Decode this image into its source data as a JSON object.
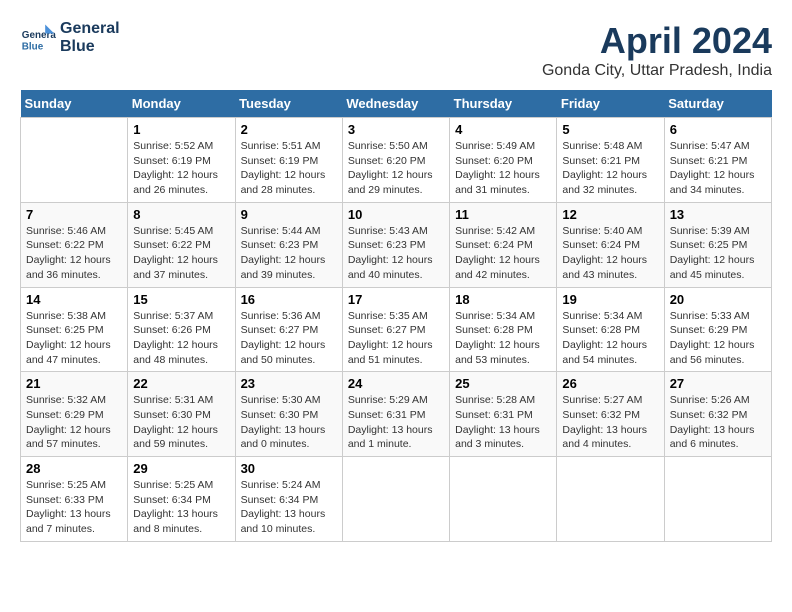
{
  "header": {
    "logo_line1": "General",
    "logo_line2": "Blue",
    "month_year": "April 2024",
    "location": "Gonda City, Uttar Pradesh, India"
  },
  "days_of_week": [
    "Sunday",
    "Monday",
    "Tuesday",
    "Wednesday",
    "Thursday",
    "Friday",
    "Saturday"
  ],
  "weeks": [
    [
      {
        "day": "",
        "info": ""
      },
      {
        "day": "1",
        "info": "Sunrise: 5:52 AM\nSunset: 6:19 PM\nDaylight: 12 hours\nand 26 minutes."
      },
      {
        "day": "2",
        "info": "Sunrise: 5:51 AM\nSunset: 6:19 PM\nDaylight: 12 hours\nand 28 minutes."
      },
      {
        "day": "3",
        "info": "Sunrise: 5:50 AM\nSunset: 6:20 PM\nDaylight: 12 hours\nand 29 minutes."
      },
      {
        "day": "4",
        "info": "Sunrise: 5:49 AM\nSunset: 6:20 PM\nDaylight: 12 hours\nand 31 minutes."
      },
      {
        "day": "5",
        "info": "Sunrise: 5:48 AM\nSunset: 6:21 PM\nDaylight: 12 hours\nand 32 minutes."
      },
      {
        "day": "6",
        "info": "Sunrise: 5:47 AM\nSunset: 6:21 PM\nDaylight: 12 hours\nand 34 minutes."
      }
    ],
    [
      {
        "day": "7",
        "info": "Sunrise: 5:46 AM\nSunset: 6:22 PM\nDaylight: 12 hours\nand 36 minutes."
      },
      {
        "day": "8",
        "info": "Sunrise: 5:45 AM\nSunset: 6:22 PM\nDaylight: 12 hours\nand 37 minutes."
      },
      {
        "day": "9",
        "info": "Sunrise: 5:44 AM\nSunset: 6:23 PM\nDaylight: 12 hours\nand 39 minutes."
      },
      {
        "day": "10",
        "info": "Sunrise: 5:43 AM\nSunset: 6:23 PM\nDaylight: 12 hours\nand 40 minutes."
      },
      {
        "day": "11",
        "info": "Sunrise: 5:42 AM\nSunset: 6:24 PM\nDaylight: 12 hours\nand 42 minutes."
      },
      {
        "day": "12",
        "info": "Sunrise: 5:40 AM\nSunset: 6:24 PM\nDaylight: 12 hours\nand 43 minutes."
      },
      {
        "day": "13",
        "info": "Sunrise: 5:39 AM\nSunset: 6:25 PM\nDaylight: 12 hours\nand 45 minutes."
      }
    ],
    [
      {
        "day": "14",
        "info": "Sunrise: 5:38 AM\nSunset: 6:25 PM\nDaylight: 12 hours\nand 47 minutes."
      },
      {
        "day": "15",
        "info": "Sunrise: 5:37 AM\nSunset: 6:26 PM\nDaylight: 12 hours\nand 48 minutes."
      },
      {
        "day": "16",
        "info": "Sunrise: 5:36 AM\nSunset: 6:27 PM\nDaylight: 12 hours\nand 50 minutes."
      },
      {
        "day": "17",
        "info": "Sunrise: 5:35 AM\nSunset: 6:27 PM\nDaylight: 12 hours\nand 51 minutes."
      },
      {
        "day": "18",
        "info": "Sunrise: 5:34 AM\nSunset: 6:28 PM\nDaylight: 12 hours\nand 53 minutes."
      },
      {
        "day": "19",
        "info": "Sunrise: 5:34 AM\nSunset: 6:28 PM\nDaylight: 12 hours\nand 54 minutes."
      },
      {
        "day": "20",
        "info": "Sunrise: 5:33 AM\nSunset: 6:29 PM\nDaylight: 12 hours\nand 56 minutes."
      }
    ],
    [
      {
        "day": "21",
        "info": "Sunrise: 5:32 AM\nSunset: 6:29 PM\nDaylight: 12 hours\nand 57 minutes."
      },
      {
        "day": "22",
        "info": "Sunrise: 5:31 AM\nSunset: 6:30 PM\nDaylight: 12 hours\nand 59 minutes."
      },
      {
        "day": "23",
        "info": "Sunrise: 5:30 AM\nSunset: 6:30 PM\nDaylight: 13 hours\nand 0 minutes."
      },
      {
        "day": "24",
        "info": "Sunrise: 5:29 AM\nSunset: 6:31 PM\nDaylight: 13 hours\nand 1 minute."
      },
      {
        "day": "25",
        "info": "Sunrise: 5:28 AM\nSunset: 6:31 PM\nDaylight: 13 hours\nand 3 minutes."
      },
      {
        "day": "26",
        "info": "Sunrise: 5:27 AM\nSunset: 6:32 PM\nDaylight: 13 hours\nand 4 minutes."
      },
      {
        "day": "27",
        "info": "Sunrise: 5:26 AM\nSunset: 6:32 PM\nDaylight: 13 hours\nand 6 minutes."
      }
    ],
    [
      {
        "day": "28",
        "info": "Sunrise: 5:25 AM\nSunset: 6:33 PM\nDaylight: 13 hours\nand 7 minutes."
      },
      {
        "day": "29",
        "info": "Sunrise: 5:25 AM\nSunset: 6:34 PM\nDaylight: 13 hours\nand 8 minutes."
      },
      {
        "day": "30",
        "info": "Sunrise: 5:24 AM\nSunset: 6:34 PM\nDaylight: 13 hours\nand 10 minutes."
      },
      {
        "day": "",
        "info": ""
      },
      {
        "day": "",
        "info": ""
      },
      {
        "day": "",
        "info": ""
      },
      {
        "day": "",
        "info": ""
      }
    ]
  ]
}
